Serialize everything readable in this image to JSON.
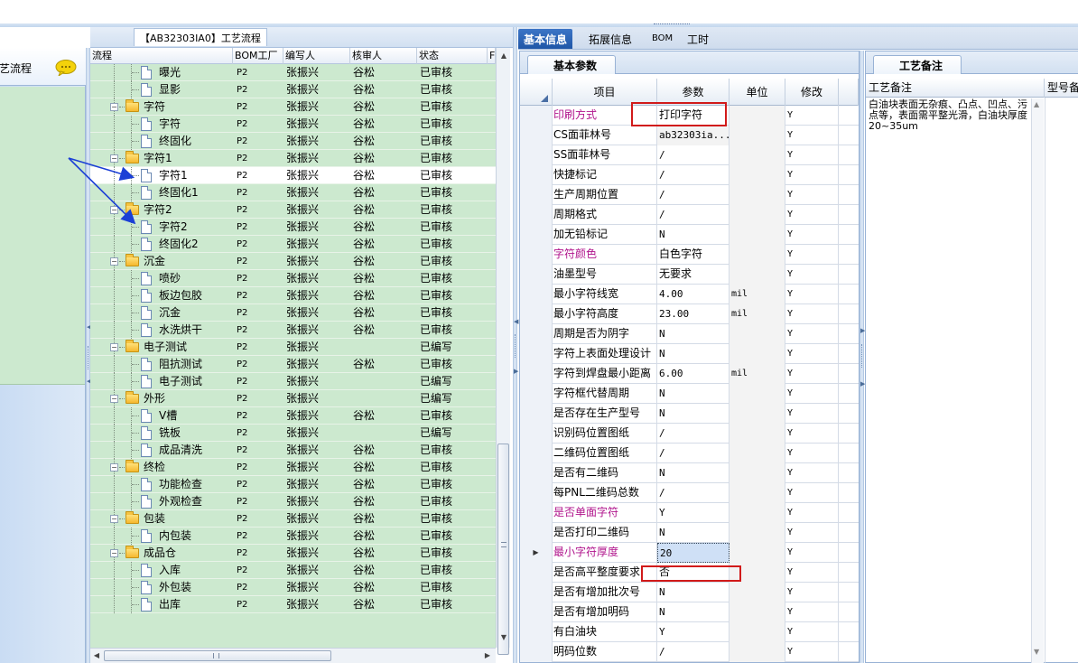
{
  "left_nav": {
    "title": "工艺流程"
  },
  "tree": {
    "caption": "【AB32303IA0】工艺流程",
    "columns": [
      "流程",
      "BOM工厂",
      "编写人",
      "核审人",
      "状态",
      "F"
    ],
    "rows": [
      {
        "name": "曝光",
        "type": "doc",
        "level": 1,
        "bom": "P2",
        "writer": "张振兴",
        "reviewer": "谷松",
        "status": "已审核"
      },
      {
        "name": "显影",
        "type": "doc",
        "level": 1,
        "bom": "P2",
        "writer": "张振兴",
        "reviewer": "谷松",
        "status": "已审核"
      },
      {
        "name": "字符",
        "type": "folder",
        "level": 0,
        "bom": "P2",
        "writer": "张振兴",
        "reviewer": "谷松",
        "status": "已审核"
      },
      {
        "name": "字符",
        "type": "doc",
        "level": 1,
        "bom": "P2",
        "writer": "张振兴",
        "reviewer": "谷松",
        "status": "已审核"
      },
      {
        "name": "终固化",
        "type": "doc",
        "level": 1,
        "bom": "P2",
        "writer": "张振兴",
        "reviewer": "谷松",
        "status": "已审核"
      },
      {
        "name": "字符1",
        "type": "folder",
        "level": 0,
        "bom": "P2",
        "writer": "张振兴",
        "reviewer": "谷松",
        "status": "已审核"
      },
      {
        "name": "字符1",
        "type": "doc",
        "level": 1,
        "bom": "P2",
        "writer": "张振兴",
        "reviewer": "谷松",
        "status": "已审核",
        "selected": true
      },
      {
        "name": "终固化1",
        "type": "doc",
        "level": 1,
        "bom": "P2",
        "writer": "张振兴",
        "reviewer": "谷松",
        "status": "已审核"
      },
      {
        "name": "字符2",
        "type": "folder",
        "level": 0,
        "bom": "P2",
        "writer": "张振兴",
        "reviewer": "谷松",
        "status": "已审核"
      },
      {
        "name": "字符2",
        "type": "doc",
        "level": 1,
        "bom": "P2",
        "writer": "张振兴",
        "reviewer": "谷松",
        "status": "已审核"
      },
      {
        "name": "终固化2",
        "type": "doc",
        "level": 1,
        "bom": "P2",
        "writer": "张振兴",
        "reviewer": "谷松",
        "status": "已审核"
      },
      {
        "name": "沉金",
        "type": "folder",
        "level": 0,
        "bom": "P2",
        "writer": "张振兴",
        "reviewer": "谷松",
        "status": "已审核"
      },
      {
        "name": "喷砂",
        "type": "doc",
        "level": 1,
        "bom": "P2",
        "writer": "张振兴",
        "reviewer": "谷松",
        "status": "已审核"
      },
      {
        "name": "板边包胶",
        "type": "doc",
        "level": 1,
        "bom": "P2",
        "writer": "张振兴",
        "reviewer": "谷松",
        "status": "已审核"
      },
      {
        "name": "沉金",
        "type": "doc",
        "level": 1,
        "bom": "P2",
        "writer": "张振兴",
        "reviewer": "谷松",
        "status": "已审核"
      },
      {
        "name": "水洗烘干",
        "type": "doc",
        "level": 1,
        "bom": "P2",
        "writer": "张振兴",
        "reviewer": "谷松",
        "status": "已审核"
      },
      {
        "name": "电子测试",
        "type": "folder",
        "level": 0,
        "bom": "P2",
        "writer": "张振兴",
        "reviewer": "",
        "status": "已编写"
      },
      {
        "name": "阻抗测试",
        "type": "doc",
        "level": 1,
        "bom": "P2",
        "writer": "张振兴",
        "reviewer": "谷松",
        "status": "已审核"
      },
      {
        "name": "电子测试",
        "type": "doc",
        "level": 1,
        "bom": "P2",
        "writer": "张振兴",
        "reviewer": "",
        "status": "已编写"
      },
      {
        "name": "外形",
        "type": "folder",
        "level": 0,
        "bom": "P2",
        "writer": "张振兴",
        "reviewer": "",
        "status": "已编写"
      },
      {
        "name": "V槽",
        "type": "doc",
        "level": 1,
        "bom": "P2",
        "writer": "张振兴",
        "reviewer": "谷松",
        "status": "已审核"
      },
      {
        "name": "铣板",
        "type": "doc",
        "level": 1,
        "bom": "P2",
        "writer": "张振兴",
        "reviewer": "",
        "status": "已编写"
      },
      {
        "name": "成品清洗",
        "type": "doc",
        "level": 1,
        "bom": "P2",
        "writer": "张振兴",
        "reviewer": "谷松",
        "status": "已审核"
      },
      {
        "name": "终检",
        "type": "folder",
        "level": 0,
        "bom": "P2",
        "writer": "张振兴",
        "reviewer": "谷松",
        "status": "已审核"
      },
      {
        "name": "功能检查",
        "type": "doc",
        "level": 1,
        "bom": "P2",
        "writer": "张振兴",
        "reviewer": "谷松",
        "status": "已审核"
      },
      {
        "name": "外观检查",
        "type": "doc",
        "level": 1,
        "bom": "P2",
        "writer": "张振兴",
        "reviewer": "谷松",
        "status": "已审核"
      },
      {
        "name": "包装",
        "type": "folder",
        "level": 0,
        "bom": "P2",
        "writer": "张振兴",
        "reviewer": "谷松",
        "status": "已审核"
      },
      {
        "name": "内包装",
        "type": "doc",
        "level": 1,
        "bom": "P2",
        "writer": "张振兴",
        "reviewer": "谷松",
        "status": "已审核"
      },
      {
        "name": "成品仓",
        "type": "folder",
        "level": 0,
        "bom": "P2",
        "writer": "张振兴",
        "reviewer": "谷松",
        "status": "已审核"
      },
      {
        "name": "入库",
        "type": "doc",
        "level": 1,
        "bom": "P2",
        "writer": "张振兴",
        "reviewer": "谷松",
        "status": "已审核"
      },
      {
        "name": "外包装",
        "type": "doc",
        "level": 1,
        "bom": "P2",
        "writer": "张振兴",
        "reviewer": "谷松",
        "status": "已审核"
      },
      {
        "name": "出库",
        "type": "doc",
        "level": 1,
        "bom": "P2",
        "writer": "张振兴",
        "reviewer": "谷松",
        "status": "已审核"
      }
    ]
  },
  "info": {
    "tabs": [
      "基本信息",
      "拓展信息",
      "BOM",
      "工时"
    ],
    "active_tab": 0,
    "subtab": "基本参数",
    "columns": [
      "项目",
      "参数",
      "单位",
      "修改"
    ],
    "rows": [
      {
        "name": "印刷方式",
        "value": "打印字符",
        "unit": "",
        "modify": "Y",
        "pink": true
      },
      {
        "name": "CS面菲林号",
        "value": "ab32303ia...",
        "unit": "",
        "modify": "Y"
      },
      {
        "name": "SS面菲林号",
        "value": "/",
        "unit": "",
        "modify": "Y"
      },
      {
        "name": "快捷标记",
        "value": "/",
        "unit": "",
        "modify": "Y"
      },
      {
        "name": "生产周期位置",
        "value": "/",
        "unit": "",
        "modify": "Y"
      },
      {
        "name": "周期格式",
        "value": "/",
        "unit": "",
        "modify": "Y"
      },
      {
        "name": "加无铅标记",
        "value": "N",
        "unit": "",
        "modify": "Y"
      },
      {
        "name": "字符颜色",
        "value": "白色字符",
        "unit": "",
        "modify": "Y",
        "pink": true
      },
      {
        "name": "油墨型号",
        "value": "无要求",
        "unit": "",
        "modify": "Y"
      },
      {
        "name": "最小字符线宽",
        "value": "4.00",
        "unit": "mil",
        "modify": "Y"
      },
      {
        "name": "最小字符高度",
        "value": "23.00",
        "unit": "mil",
        "modify": "Y"
      },
      {
        "name": "周期是否为阴字",
        "value": "N",
        "unit": "",
        "modify": "Y"
      },
      {
        "name": "字符上表面处理设计",
        "value": "N",
        "unit": "",
        "modify": "Y"
      },
      {
        "name": "字符到焊盘最小距离",
        "value": "6.00",
        "unit": "mil",
        "modify": "Y"
      },
      {
        "name": "字符框代替周期",
        "value": "N",
        "unit": "",
        "modify": "Y"
      },
      {
        "name": "是否存在生产型号",
        "value": "N",
        "unit": "",
        "modify": "Y"
      },
      {
        "name": "识别码位置图纸",
        "value": "/",
        "unit": "",
        "modify": "Y"
      },
      {
        "name": "二维码位置图纸",
        "value": "/",
        "unit": "",
        "modify": "Y"
      },
      {
        "name": "是否有二维码",
        "value": "N",
        "unit": "",
        "modify": "Y"
      },
      {
        "name": "每PNL二维码总数",
        "value": "/",
        "unit": "",
        "modify": "Y"
      },
      {
        "name": "是否单面字符",
        "value": "Y",
        "unit": "",
        "modify": "Y",
        "pink": true
      },
      {
        "name": "是否打印二维码",
        "value": "N",
        "unit": "",
        "modify": "Y"
      },
      {
        "name": "最小字符厚度",
        "value": "20",
        "unit": "",
        "modify": "Y",
        "pink": true,
        "current": true
      },
      {
        "name": "是否高平整度要求",
        "value": "否",
        "unit": "",
        "modify": "Y"
      },
      {
        "name": "是否有增加批次号",
        "value": "N",
        "unit": "",
        "modify": "Y"
      },
      {
        "name": "是否有增加明码",
        "value": "N",
        "unit": "",
        "modify": "Y"
      },
      {
        "name": "有白油块",
        "value": "Y",
        "unit": "",
        "modify": "Y"
      },
      {
        "name": "明码位数",
        "value": "/",
        "unit": "",
        "modify": "Y"
      }
    ]
  },
  "remark": {
    "tab": "工艺备注",
    "columns": [
      "工艺备注",
      "型号备"
    ],
    "text": "白油块表面无杂痕、凸点、凹点、污点等，表面需平整光滑，白油块厚度20~35um"
  },
  "colors": {
    "tree_bg": "#cce9cf",
    "tab_active": "#1f56a7",
    "highlight_box": "#d11a1a",
    "pink_label": "#b0148c",
    "arrow": "#1b3fd6"
  }
}
